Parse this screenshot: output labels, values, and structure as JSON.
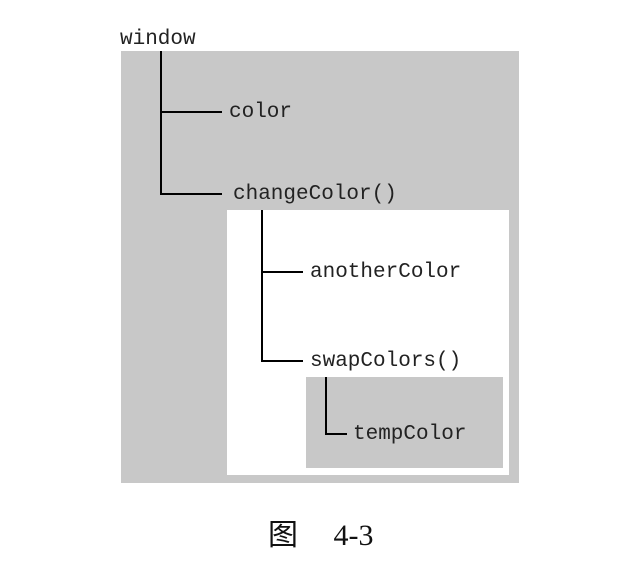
{
  "scopes": {
    "global": "window",
    "global_vars": [
      "color",
      "changeColor()"
    ],
    "function_vars": [
      "anotherColor",
      "swapColors()"
    ],
    "inner_vars": [
      "tempColor"
    ]
  },
  "caption": {
    "label": "图",
    "number": "4-3"
  },
  "colors": {
    "scope_fill": "#c8c8c8",
    "line": "#000000"
  }
}
